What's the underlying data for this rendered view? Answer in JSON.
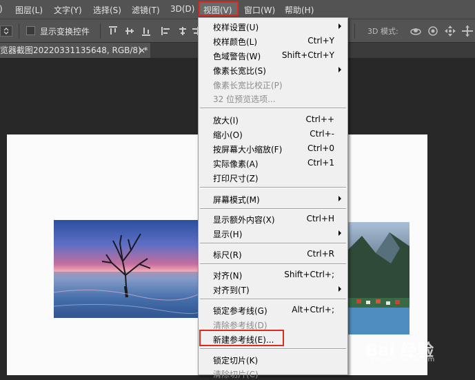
{
  "menubar": {
    "items": [
      "图层(L)",
      "文字(Y)",
      "选择(S)",
      "滤镜(T)",
      "3D(D)",
      "视图(V)",
      "窗口(W)",
      "帮助(H)"
    ]
  },
  "options": {
    "show_transform_controls": "显示变换控件",
    "mode_3d": "3D 模式:"
  },
  "doc_tab": {
    "title": "览器截图20220331135648, RGB/8) *",
    "close": "×"
  },
  "view_menu": {
    "items": [
      {
        "label": "校样设置(U)",
        "shortcut": "",
        "submenu": true,
        "disabled": false
      },
      {
        "label": "校样颜色(L)",
        "shortcut": "Ctrl+Y",
        "submenu": false,
        "disabled": false
      },
      {
        "label": "色域警告(W)",
        "shortcut": "Shift+Ctrl+Y",
        "submenu": false,
        "disabled": false
      },
      {
        "label": "像素长宽比(S)",
        "shortcut": "",
        "submenu": true,
        "disabled": false
      },
      {
        "label": "像素长宽比校正(P)",
        "shortcut": "",
        "submenu": false,
        "disabled": true
      },
      {
        "label": "32 位预览选项...",
        "shortcut": "",
        "submenu": false,
        "disabled": true
      },
      {
        "label": "放大(I)",
        "shortcut": "Ctrl++",
        "submenu": false,
        "disabled": false
      },
      {
        "label": "缩小(O)",
        "shortcut": "Ctrl+-",
        "submenu": false,
        "disabled": false
      },
      {
        "label": "按屏幕大小缩放(F)",
        "shortcut": "Ctrl+0",
        "submenu": false,
        "disabled": false
      },
      {
        "label": "实际像素(A)",
        "shortcut": "Ctrl+1",
        "submenu": false,
        "disabled": false
      },
      {
        "label": "打印尺寸(Z)",
        "shortcut": "",
        "submenu": false,
        "disabled": false
      },
      {
        "label": "屏幕模式(M)",
        "shortcut": "",
        "submenu": true,
        "disabled": false
      },
      {
        "label": "显示额外内容(X)",
        "shortcut": "Ctrl+H",
        "submenu": false,
        "disabled": false
      },
      {
        "label": "显示(H)",
        "shortcut": "",
        "submenu": true,
        "disabled": false
      },
      {
        "label": "标尺(R)",
        "shortcut": "Ctrl+R",
        "submenu": false,
        "disabled": false
      },
      {
        "label": "对齐(N)",
        "shortcut": "Shift+Ctrl+;",
        "submenu": false,
        "disabled": false
      },
      {
        "label": "对齐到(T)",
        "shortcut": "",
        "submenu": true,
        "disabled": false
      },
      {
        "label": "锁定参考线(G)",
        "shortcut": "Alt+Ctrl+;",
        "submenu": false,
        "disabled": false
      },
      {
        "label": "清除参考线(D)",
        "shortcut": "",
        "submenu": false,
        "disabled": true
      },
      {
        "label": "新建参考线(E)...",
        "shortcut": "",
        "submenu": false,
        "disabled": false
      },
      {
        "label": "锁定切片(K)",
        "shortcut": "",
        "submenu": false,
        "disabled": false
      },
      {
        "label": "清除切片(C)",
        "shortcut": "",
        "submenu": false,
        "disabled": true
      }
    ]
  },
  "watermark": {
    "text": "Bai 经验",
    "url": "jingyan.baidu.com"
  },
  "colors": {
    "highlight_red": "#e0281f",
    "menu_bg": "#f0f0f0",
    "chrome_bg": "#535353",
    "workspace_bg": "#282828"
  }
}
